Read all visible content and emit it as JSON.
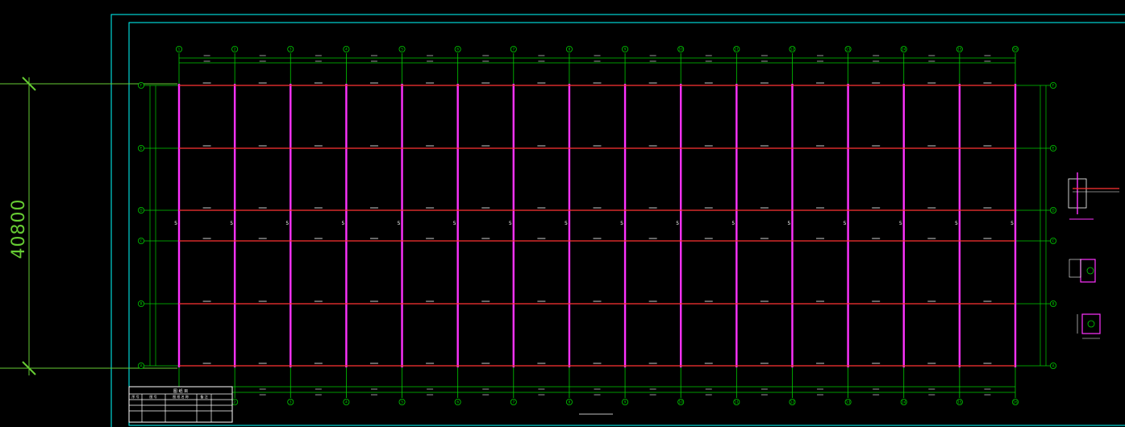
{
  "drawing": {
    "overall_dimension_label": "40800",
    "grid_x_labels": [
      "1",
      "2",
      "3",
      "4",
      "5",
      "6",
      "7",
      "8",
      "9",
      "10",
      "11",
      "12",
      "13",
      "14",
      "15",
      "16"
    ],
    "grid_y_labels": [
      "F",
      "E",
      "D",
      "C",
      "B",
      "A"
    ],
    "bay_marker": "5",
    "colors": {
      "background": "#000000",
      "grid_line": "#00cc00",
      "frame": "#00ffff",
      "columns": "#ff33ff",
      "beams": "#ff3333",
      "text": "#ffffff",
      "dimension": "#66cc33"
    }
  },
  "title_block": {
    "header": "图 纸 目",
    "rows": [
      [
        "序 号",
        "图 号",
        "图 纸 名 称",
        "备 注"
      ],
      [
        "",
        "",
        "",
        ""
      ],
      [
        "",
        "",
        "",
        ""
      ]
    ]
  }
}
